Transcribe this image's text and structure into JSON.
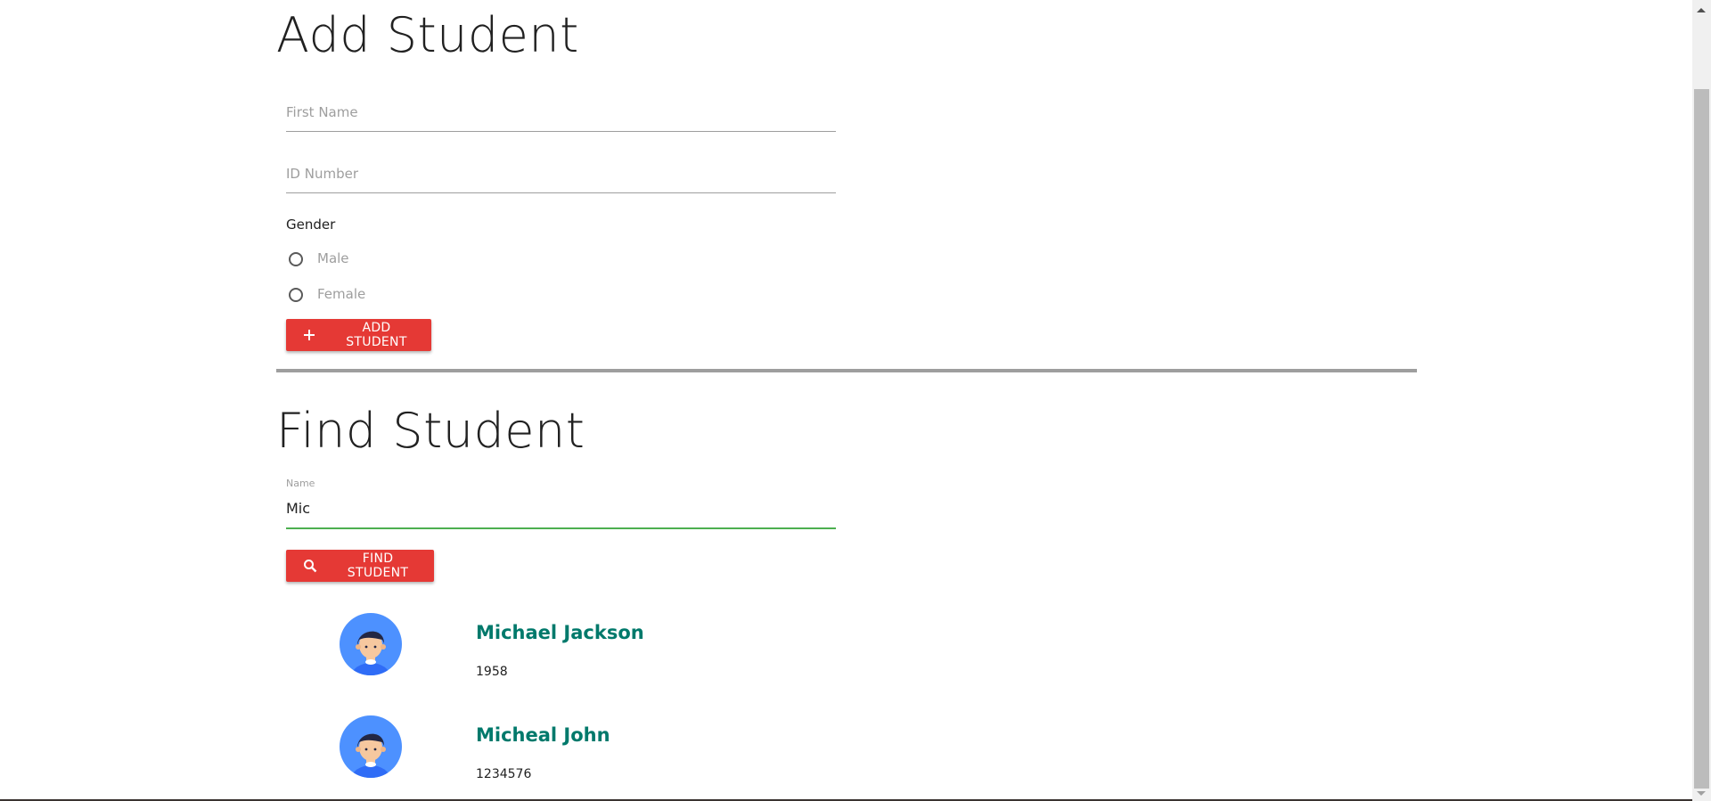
{
  "add_section": {
    "title": "Add Student",
    "first_name_placeholder": "First Name",
    "id_number_placeholder": "ID Number",
    "gender_label": "Gender",
    "gender_options": [
      "Male",
      "Female"
    ],
    "add_button_label": "ADD STUDENT"
  },
  "find_section": {
    "title": "Find Student",
    "name_label": "Name",
    "name_value": "Mic",
    "find_button_label": "FIND STUDENT"
  },
  "results": [
    {
      "name": "Michael Jackson",
      "id": "1958",
      "icon": "avatar-boy"
    },
    {
      "name": "Micheal John",
      "id": "1234576",
      "icon": "avatar-boy"
    }
  ],
  "colors": {
    "accent": "#e53935",
    "focus": "#4caf50",
    "name": "#00796b"
  }
}
